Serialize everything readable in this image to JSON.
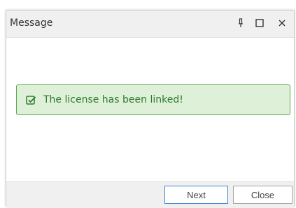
{
  "window": {
    "title": "Message",
    "pin_icon": "pin-icon",
    "maximize_icon": "maximize-icon",
    "close_icon": "close-icon"
  },
  "alert": {
    "icon": "checkbox-checked-icon",
    "message": "The license has been linked!",
    "colors": {
      "background": "#dff0d8",
      "border": "#5aa64e",
      "text": "#2e7a30"
    }
  },
  "footer": {
    "next_label": "Next",
    "close_label": "Close"
  }
}
